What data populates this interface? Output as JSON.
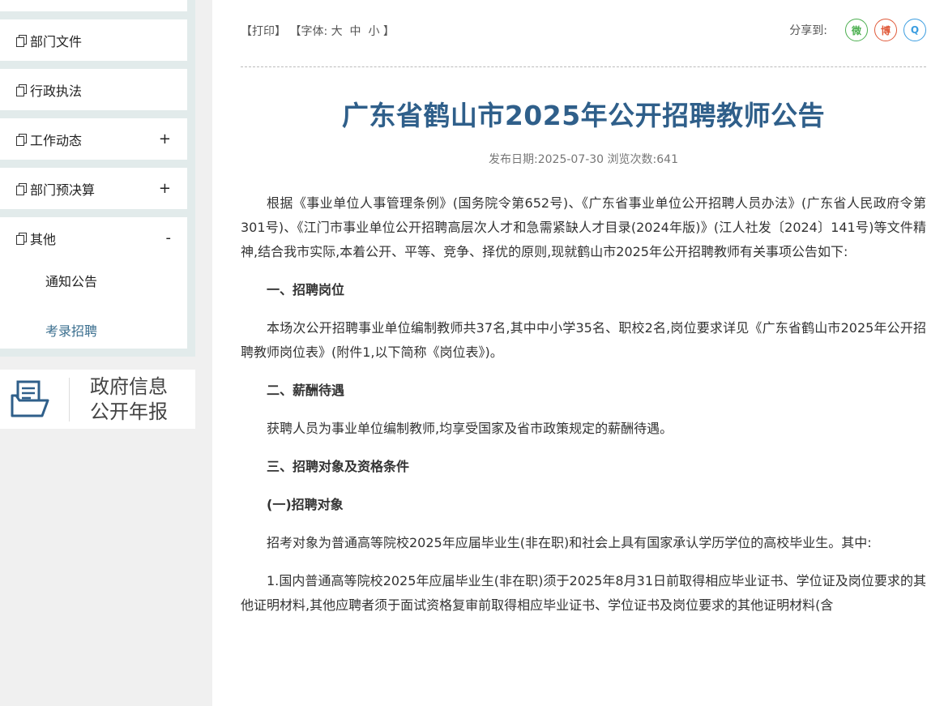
{
  "sidebar": {
    "items": [
      {
        "label": "部门文件",
        "toggle": ""
      },
      {
        "label": "行政执法",
        "toggle": ""
      },
      {
        "label": "工作动态",
        "toggle": "+"
      },
      {
        "label": "部门预决算",
        "toggle": "+"
      },
      {
        "label": "其他",
        "toggle": "-"
      }
    ],
    "subitems": [
      {
        "label": "通知公告",
        "color": "#222222"
      },
      {
        "label": "考录招聘",
        "color": "#3b6f8f"
      }
    ],
    "report": {
      "line1": "政府信息",
      "line2": "公开年报"
    }
  },
  "toolbar": {
    "print": "【打印】",
    "font_prefix": "【字体:",
    "font_large": "大",
    "font_medium": "中",
    "font_small": "小",
    "font_suffix": "】"
  },
  "share": {
    "label": "分享到:",
    "wechat": "微",
    "weibo": "博",
    "qq": "Q"
  },
  "article": {
    "title": "广东省鹤山市2025年公开招聘教师公告",
    "meta": "发布日期:2025-07-30  浏览次数:641",
    "paragraphs": [
      "根据《事业单位人事管理条例》(国务院令第652号)、《广东省事业单位公开招聘人员办法》(广东省人民政府令第301号)、《江门市事业单位公开招聘高层次人才和急需紧缺人才目录(2024年版)》(江人社发〔2024〕141号)等文件精神,结合我市实际,本着公开、平等、竞争、择优的原则,现就鹤山市2025年公开招聘教师有关事项公告如下:",
      "一、招聘岗位",
      "本场次公开招聘事业单位编制教师共37名,其中中小学35名、职校2名,岗位要求详见《广东省鹤山市2025年公开招聘教师岗位表》(附件1,以下简称《岗位表》)。",
      "二、薪酬待遇",
      "获聘人员为事业单位编制教师,均享受国家及省市政策规定的薪酬待遇。",
      "三、招聘对象及资格条件",
      "(一)招聘对象",
      "招考对象为普通高等院校2025年应届毕业生(非在职)和社会上具有国家承认学历学位的高校毕业生。其中:",
      "1.国内普通高等院校2025年应届毕业生(非在职)须于2025年8月31日前取得相应毕业证书、学位证及岗位要求的其他证明材料,其他应聘者须于面试资格复审前取得相应毕业证书、学位证书及岗位要求的其他证明材料(含"
    ]
  }
}
